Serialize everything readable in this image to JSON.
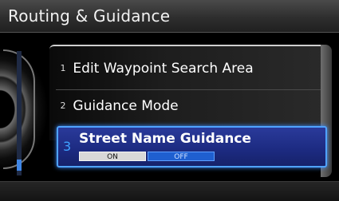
{
  "title": "Routing & Guidance",
  "menu": {
    "items": [
      {
        "number": "1",
        "label": "Edit Waypoint Search Area"
      },
      {
        "number": "2",
        "label": "Guidance Mode"
      }
    ],
    "selected": {
      "number": "3",
      "label": "Street Name Guidance",
      "options": [
        "ON",
        "OFF"
      ],
      "current_value": "OFF"
    }
  },
  "colors": {
    "selection_fill": "#1c2a80",
    "selection_border": "#4fa3ff",
    "option_active": "#1f5fd0",
    "accent_number": "#3fa2ff"
  },
  "icons": [
    "control-knob-icon"
  ]
}
